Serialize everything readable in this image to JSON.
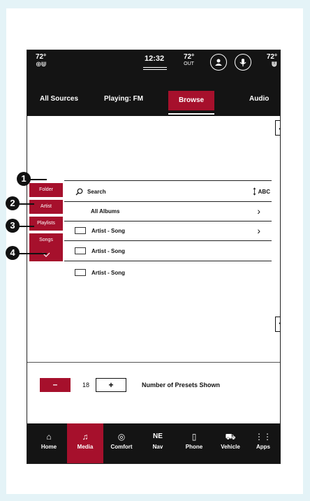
{
  "status": {
    "driver_temp": "72°",
    "driver_seat_icons": "⊕⋓",
    "clock": "12:32",
    "outside_temp": "72°",
    "outside_label": "OUT",
    "profile_icon": "profile-icon",
    "voice_icon": "microphone-icon",
    "passenger_temp": "72°",
    "passenger_seat_icons": "⋓"
  },
  "tabs": [
    {
      "label": "All Sources"
    },
    {
      "label": "Playing: FM"
    },
    {
      "label": "Browse",
      "active": true
    },
    {
      "label": "Audio"
    }
  ],
  "browse": {
    "search_label": "Search",
    "abc_label": "ABC",
    "rows": [
      {
        "label": "All Albums",
        "chevron": "›"
      },
      {
        "label": "Artist - Song",
        "chevron": "›"
      },
      {
        "label": "Artist - Song"
      },
      {
        "label": "Artist - Song"
      }
    ],
    "categories": [
      "Folder",
      "Artist",
      "Playlists",
      "Songs"
    ],
    "more_icon": "chevron-down-icon"
  },
  "callouts": [
    "1",
    "2",
    "3",
    "4"
  ],
  "presets": {
    "minus": "–",
    "count": "18",
    "plus": "+",
    "label": "Number of Presets Shown"
  },
  "nav": [
    {
      "label": "Home",
      "icon": "⌂"
    },
    {
      "label": "Media",
      "icon": "♫",
      "active": true
    },
    {
      "label": "Comfort",
      "icon": "◎"
    },
    {
      "label": "Nav",
      "icon": "NE"
    },
    {
      "label": "Phone",
      "icon": "▯"
    },
    {
      "label": "Vehicle",
      "icon": "⛟"
    },
    {
      "label": "Apps",
      "icon": "⋮⋮"
    }
  ],
  "colors": {
    "accent": "#a6102c",
    "bar": "#141414",
    "background": "#e4f3f7"
  }
}
